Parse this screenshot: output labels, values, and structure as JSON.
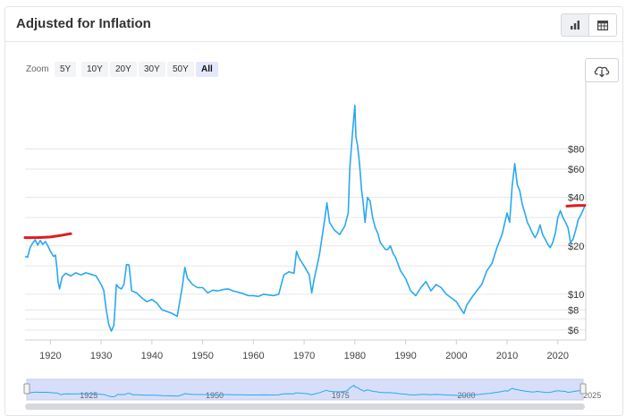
{
  "header": {
    "title": "Adjusted for Inflation"
  },
  "toolbar": {
    "chart_view_icon": "bar-chart-icon",
    "table_view_icon": "table-icon",
    "download_icon": "cloud-download-icon"
  },
  "zoom": {
    "label": "Zoom",
    "options": [
      "5Y",
      "10Y",
      "20Y",
      "30Y",
      "50Y",
      "All"
    ],
    "selected": "All"
  },
  "colors": {
    "line": "#2aa8f0",
    "annotation": "#e01b1b",
    "navigator_fill": "#c9d3f8"
  },
  "navigator": {
    "labels": [
      "1925",
      "1950",
      "1975",
      "2000",
      "2025"
    ]
  },
  "chart_data": {
    "type": "line",
    "title": "",
    "xlabel": "",
    "ylabel": "",
    "y_scale": "log",
    "xlim": [
      1915,
      2025.5
    ],
    "ylim": [
      5.2,
      200
    ],
    "x_ticks": [
      1920,
      1930,
      1940,
      1950,
      1960,
      1970,
      1980,
      1990,
      2000,
      2010,
      2020
    ],
    "y_ticks": [
      {
        "value": 6,
        "label": "$6"
      },
      {
        "value": 8,
        "label": "$8"
      },
      {
        "value": 10,
        "label": "$10"
      },
      {
        "value": 20,
        "label": "$20"
      },
      {
        "value": 40,
        "label": "$40"
      },
      {
        "value": 60,
        "label": "$60"
      },
      {
        "value": 80,
        "label": "$80"
      }
    ],
    "grid": "horizontal",
    "series": [
      {
        "points": [
          [
            1915.0,
            17.2
          ],
          [
            1915.5,
            17.0
          ],
          [
            1916.0,
            19.5
          ],
          [
            1916.5,
            20.8
          ],
          [
            1917.0,
            21.8
          ],
          [
            1917.5,
            20.2
          ],
          [
            1918.0,
            21.6
          ],
          [
            1918.5,
            20.4
          ],
          [
            1919.0,
            21.3
          ],
          [
            1919.5,
            20.0
          ],
          [
            1920.0,
            18.5
          ],
          [
            1920.6,
            17.2
          ],
          [
            1921.0,
            17.5
          ],
          [
            1921.3,
            14.5
          ],
          [
            1921.5,
            12.0
          ],
          [
            1921.8,
            10.8
          ],
          [
            1922.3,
            12.8
          ],
          [
            1923.0,
            13.5
          ],
          [
            1924.0,
            13.0
          ],
          [
            1925.0,
            13.6
          ],
          [
            1926.0,
            13.2
          ],
          [
            1927.0,
            13.6
          ],
          [
            1928.0,
            13.3
          ],
          [
            1929.0,
            13.0
          ],
          [
            1930.0,
            11.5
          ],
          [
            1930.5,
            10.6
          ],
          [
            1931.0,
            8.0
          ],
          [
            1931.5,
            6.5
          ],
          [
            1932.0,
            5.9
          ],
          [
            1932.5,
            6.4
          ],
          [
            1932.8,
            8.9
          ],
          [
            1933.0,
            11.5
          ],
          [
            1933.5,
            11.0
          ],
          [
            1934.0,
            10.8
          ],
          [
            1934.5,
            11.5
          ],
          [
            1935.0,
            15.3
          ],
          [
            1935.5,
            15.2
          ],
          [
            1936.0,
            10.5
          ],
          [
            1937.0,
            10.2
          ],
          [
            1938.0,
            9.5
          ],
          [
            1939.0,
            9.0
          ],
          [
            1940.0,
            9.3
          ],
          [
            1941.0,
            8.8
          ],
          [
            1942.0,
            8.0
          ],
          [
            1943.0,
            7.8
          ],
          [
            1944.0,
            7.6
          ],
          [
            1945.0,
            7.3
          ],
          [
            1946.0,
            11.2
          ],
          [
            1946.5,
            14.7
          ],
          [
            1947.0,
            12.6
          ],
          [
            1948.0,
            11.5
          ],
          [
            1949.0,
            11.0
          ],
          [
            1950.0,
            11.0
          ],
          [
            1951.0,
            10.2
          ],
          [
            1952.0,
            10.6
          ],
          [
            1953.0,
            10.5
          ],
          [
            1954.0,
            10.7
          ],
          [
            1955.0,
            10.8
          ],
          [
            1956.0,
            10.5
          ],
          [
            1957.0,
            10.3
          ],
          [
            1958.0,
            10.1
          ],
          [
            1959.0,
            9.8
          ],
          [
            1960.0,
            9.8
          ],
          [
            1961.0,
            9.7
          ],
          [
            1962.0,
            10.0
          ],
          [
            1963.0,
            9.9
          ],
          [
            1964.0,
            9.8
          ],
          [
            1965.0,
            10.0
          ],
          [
            1966.0,
            13.2
          ],
          [
            1967.0,
            13.8
          ],
          [
            1968.0,
            13.5
          ],
          [
            1968.5,
            18.5
          ],
          [
            1969.0,
            16.8
          ],
          [
            1970.0,
            15.0
          ],
          [
            1971.0,
            13.2
          ],
          [
            1971.5,
            10.2
          ],
          [
            1972.0,
            12.5
          ],
          [
            1973.0,
            17.5
          ],
          [
            1974.0,
            28.5
          ],
          [
            1974.5,
            37.0
          ],
          [
            1975.0,
            28.0
          ],
          [
            1976.0,
            25.0
          ],
          [
            1977.0,
            23.5
          ],
          [
            1978.0,
            26.5
          ],
          [
            1978.7,
            32.0
          ],
          [
            1979.0,
            60.0
          ],
          [
            1979.5,
            98.0
          ],
          [
            1980.0,
            150.0
          ],
          [
            1980.2,
            95.0
          ],
          [
            1980.5,
            85.0
          ],
          [
            1980.8,
            70.0
          ],
          [
            1981.0,
            60.0
          ],
          [
            1981.3,
            45.0
          ],
          [
            1981.6,
            38.0
          ],
          [
            1982.0,
            28.0
          ],
          [
            1982.5,
            40.0
          ],
          [
            1983.0,
            38.0
          ],
          [
            1983.5,
            30.0
          ],
          [
            1984.0,
            26.0
          ],
          [
            1984.5,
            24.0
          ],
          [
            1985.0,
            21.0
          ],
          [
            1985.5,
            20.0
          ],
          [
            1986.0,
            19.0
          ],
          [
            1986.5,
            19.0
          ],
          [
            1987.0,
            20.0
          ],
          [
            1987.5,
            18.0
          ],
          [
            1988.0,
            17.0
          ],
          [
            1989.0,
            14.0
          ],
          [
            1990.0,
            12.5
          ],
          [
            1991.0,
            10.5
          ],
          [
            1992.0,
            9.8
          ],
          [
            1993.0,
            11.0
          ],
          [
            1994.0,
            12.0
          ],
          [
            1995.0,
            10.5
          ],
          [
            1996.0,
            11.5
          ],
          [
            1997.0,
            11.0
          ],
          [
            1998.0,
            10.0
          ],
          [
            1999.0,
            9.5
          ],
          [
            2000.0,
            9.0
          ],
          [
            2001.0,
            8.0
          ],
          [
            2001.5,
            7.6
          ],
          [
            2002.0,
            8.5
          ],
          [
            2003.0,
            9.5
          ],
          [
            2004.0,
            10.5
          ],
          [
            2005.0,
            11.5
          ],
          [
            2006.0,
            14.0
          ],
          [
            2007.0,
            15.5
          ],
          [
            2008.0,
            19.5
          ],
          [
            2009.0,
            23.5
          ],
          [
            2010.0,
            32.0
          ],
          [
            2010.5,
            28.0
          ],
          [
            2011.0,
            47.0
          ],
          [
            2011.5,
            65.0
          ],
          [
            2012.0,
            48.0
          ],
          [
            2012.5,
            44.0
          ],
          [
            2013.0,
            36.0
          ],
          [
            2013.5,
            32.0
          ],
          [
            2014.0,
            28.0
          ],
          [
            2014.5,
            26.0
          ],
          [
            2015.0,
            24.0
          ],
          [
            2015.5,
            22.5
          ],
          [
            2016.0,
            24.0
          ],
          [
            2016.5,
            27.0
          ],
          [
            2017.0,
            23.5
          ],
          [
            2017.5,
            22.0
          ],
          [
            2018.0,
            20.5
          ],
          [
            2018.5,
            19.5
          ],
          [
            2019.0,
            21.0
          ],
          [
            2019.5,
            24.0
          ],
          [
            2020.0,
            30.0
          ],
          [
            2020.5,
            33.0
          ],
          [
            2021.0,
            30.0
          ],
          [
            2021.5,
            28.0
          ],
          [
            2022.0,
            26.0
          ],
          [
            2022.5,
            21.0
          ],
          [
            2023.0,
            22.0
          ],
          [
            2023.5,
            25.0
          ],
          [
            2024.0,
            29.0
          ],
          [
            2024.5,
            31.0
          ],
          [
            2025.0,
            33.5
          ],
          [
            2025.3,
            35.5
          ]
        ]
      }
    ],
    "annotations": [
      {
        "type": "hand-drawn-line",
        "color": "red",
        "points": [
          [
            1915.0,
            22.5
          ],
          [
            1917.5,
            22.5
          ],
          [
            1920.0,
            22.7
          ],
          [
            1922.0,
            23.2
          ],
          [
            1924.0,
            23.8
          ]
        ]
      },
      {
        "type": "hand-drawn-line",
        "color": "red",
        "points": [
          [
            2021.8,
            35.3
          ],
          [
            2023.5,
            35.6
          ],
          [
            2025.3,
            35.7
          ]
        ]
      }
    ]
  }
}
